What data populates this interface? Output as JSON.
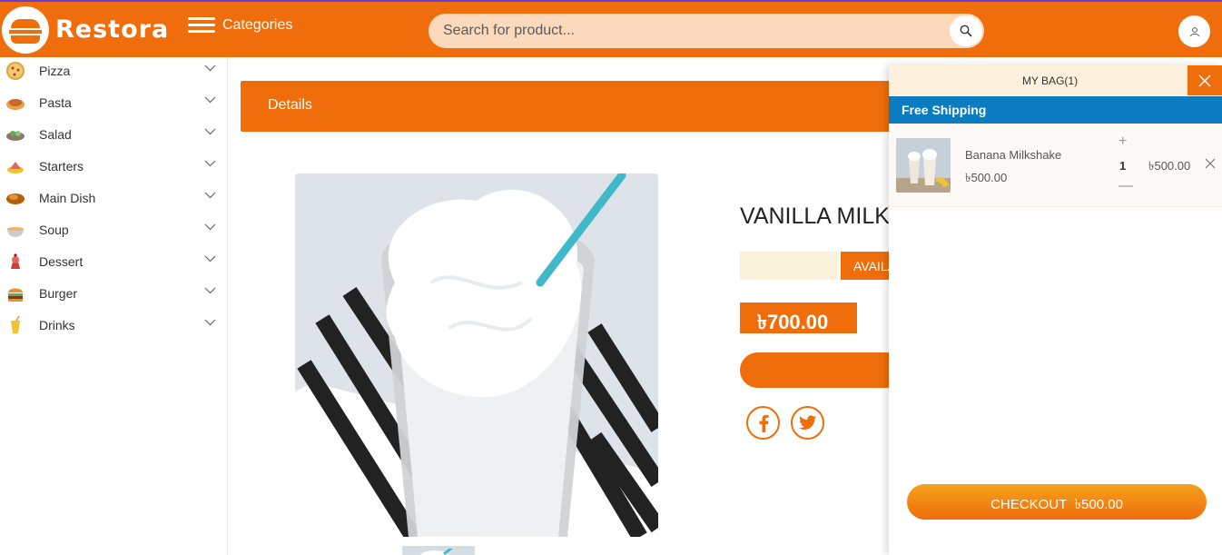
{
  "brand": {
    "name": "Restora"
  },
  "header": {
    "categories_label": "Categories",
    "search_placeholder": "Search for product..."
  },
  "sidebar": {
    "items": [
      {
        "label": "Pizza",
        "icon": "pizza-icon"
      },
      {
        "label": "Pasta",
        "icon": "pasta-icon"
      },
      {
        "label": "Salad",
        "icon": "salad-icon"
      },
      {
        "label": "Starters",
        "icon": "starters-icon"
      },
      {
        "label": "Main Dish",
        "icon": "main-dish-icon"
      },
      {
        "label": "Soup",
        "icon": "soup-icon"
      },
      {
        "label": "Dessert",
        "icon": "dessert-icon"
      },
      {
        "label": "Burger",
        "icon": "burger-icon"
      },
      {
        "label": "Drinks",
        "icon": "drinks-icon"
      }
    ]
  },
  "details": {
    "tab_label": "Details",
    "product_title": "VANILLA MILK",
    "availability": "AVAILABLE",
    "price": "৳700.00"
  },
  "bag": {
    "title": "MY BAG(1)",
    "shipping": "Free Shipping",
    "items": [
      {
        "name": "Banana Milkshake",
        "unit_price": "৳500.00",
        "quantity": "1",
        "total": "৳500.00"
      }
    ],
    "checkout_label": "CHECKOUT",
    "checkout_total": "৳500.00"
  },
  "colors": {
    "accent": "#ef6d0b",
    "shipping_bar": "#0b7cc2"
  }
}
